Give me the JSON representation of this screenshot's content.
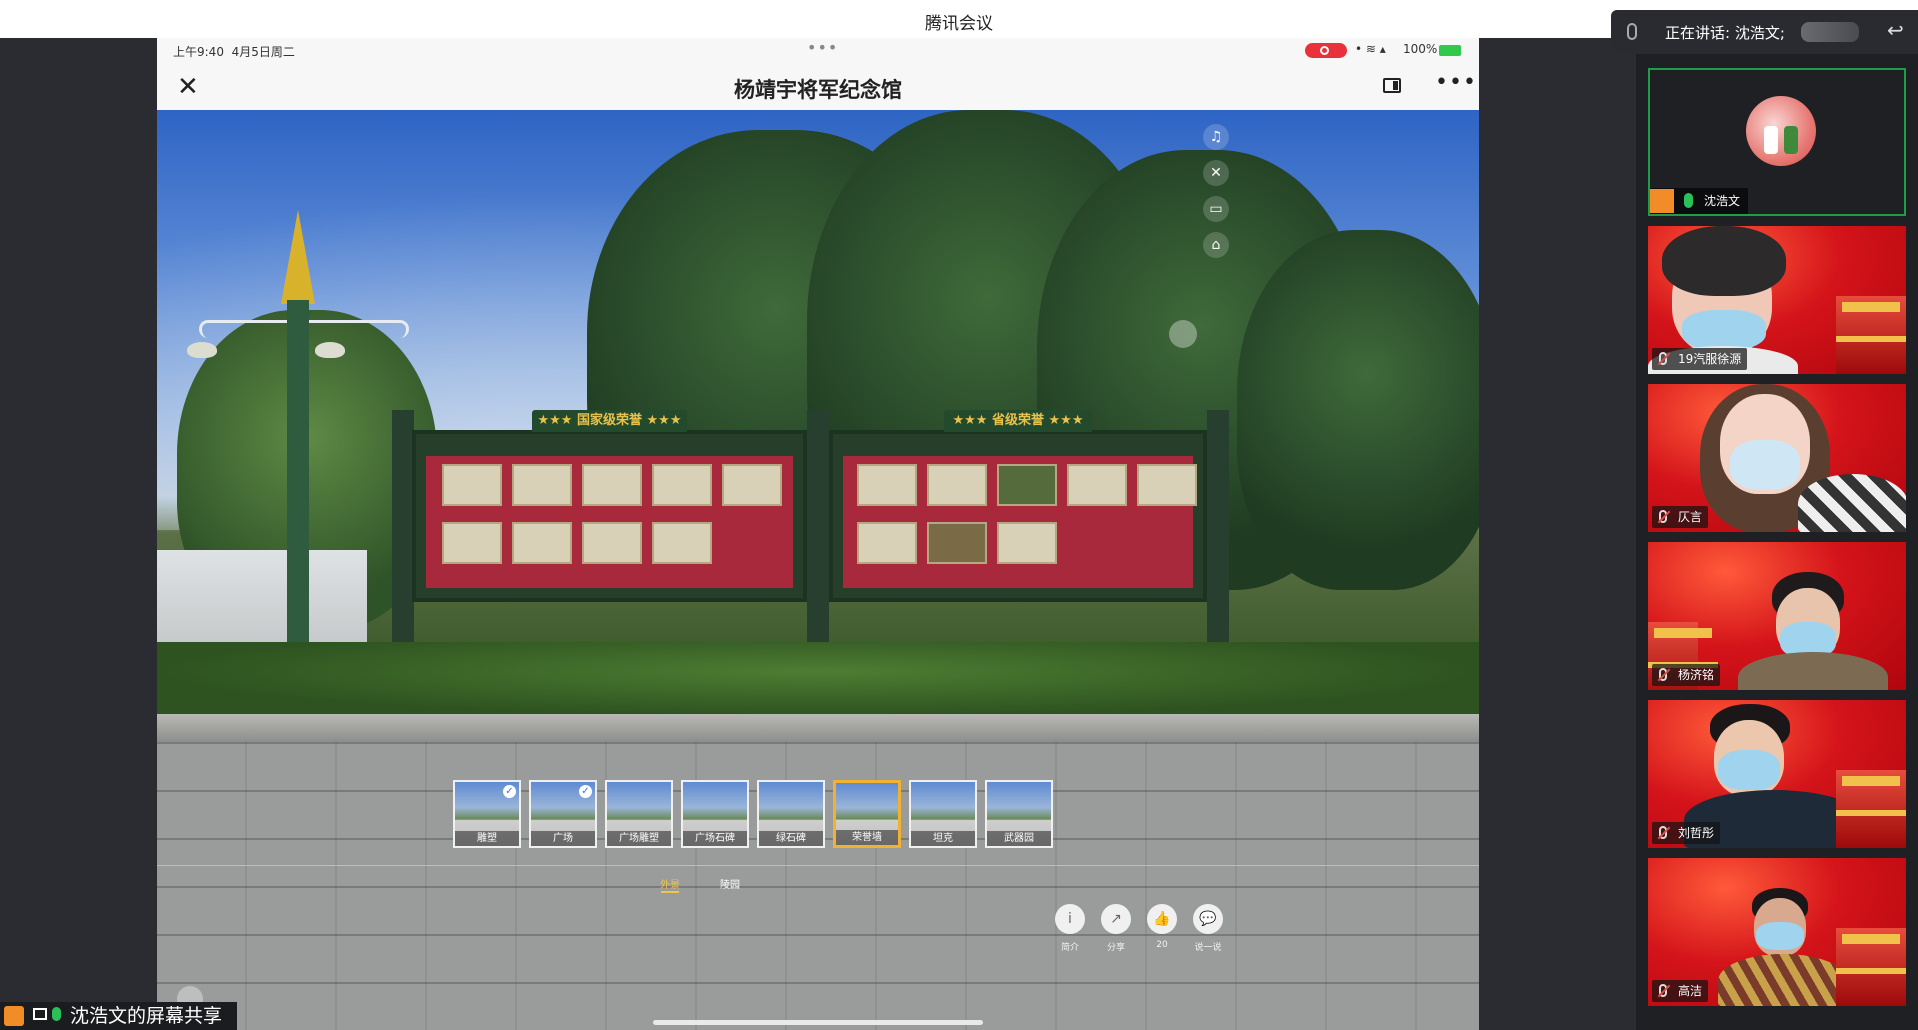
{
  "window": {
    "title": "腾讯会议"
  },
  "device_status": {
    "time": "上午9:40",
    "date": "4月5日周二",
    "battery": "100%"
  },
  "app": {
    "page_title": "杨靖宇将军纪念馆"
  },
  "scene": {
    "board_left_title": "国家级荣誉",
    "board_right_title": "省级荣誉"
  },
  "scenes": [
    {
      "label": "雕塑",
      "checked": true,
      "active": false
    },
    {
      "label": "广场",
      "checked": true,
      "active": false
    },
    {
      "label": "广场雕塑",
      "checked": false,
      "active": false
    },
    {
      "label": "广场石碑",
      "checked": false,
      "active": false
    },
    {
      "label": "绿石碑",
      "checked": false,
      "active": false
    },
    {
      "label": "荣誉墙",
      "checked": false,
      "active": true
    },
    {
      "label": "坦克",
      "checked": false,
      "active": false
    },
    {
      "label": "武器园",
      "checked": false,
      "active": false
    }
  ],
  "scene_groups": [
    {
      "label": "外景",
      "active": true
    },
    {
      "label": "陵园",
      "active": false
    }
  ],
  "bottom_actions": [
    {
      "label": "简介",
      "icon": "info-icon"
    },
    {
      "label": "分享",
      "icon": "share-icon"
    },
    {
      "label": "20",
      "icon": "like-icon"
    },
    {
      "label": "说一说",
      "icon": "comment-icon"
    }
  ],
  "share_label": "沈浩文的屏幕共享",
  "speaking": {
    "prefix": "正在讲话: 沈浩文;"
  },
  "participants": [
    {
      "name": "沈浩文"
    },
    {
      "name": "19汽服徐源"
    },
    {
      "name": "仄言"
    },
    {
      "name": "杨济铭"
    },
    {
      "name": "刘哲彤"
    },
    {
      "name": "高洁"
    }
  ],
  "colors": {
    "speaking_border": "#1e9c4a",
    "active_thumb": "#f1b232",
    "tile_bg": "#d4141a"
  }
}
